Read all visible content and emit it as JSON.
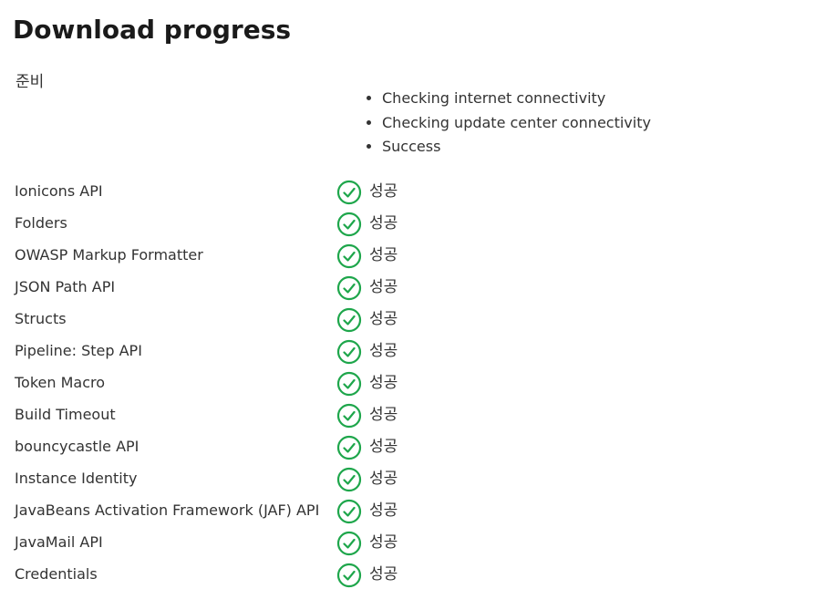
{
  "page": {
    "title": "Download progress"
  },
  "preparation": {
    "label": "준비",
    "steps": [
      "Checking internet connectivity",
      "Checking update center connectivity",
      "Success"
    ]
  },
  "plugins": [
    {
      "name": "Ionicons API",
      "status": "성공"
    },
    {
      "name": "Folders",
      "status": "성공"
    },
    {
      "name": "OWASP Markup Formatter",
      "status": "성공"
    },
    {
      "name": "JSON Path API",
      "status": "성공"
    },
    {
      "name": "Structs",
      "status": "성공"
    },
    {
      "name": "Pipeline: Step API",
      "status": "성공"
    },
    {
      "name": "Token Macro",
      "status": "성공"
    },
    {
      "name": "Build Timeout",
      "status": "성공"
    },
    {
      "name": "bouncycastle API",
      "status": "성공"
    },
    {
      "name": "Instance Identity",
      "status": "성공"
    },
    {
      "name": "JavaBeans Activation Framework (JAF) API",
      "status": "성공"
    },
    {
      "name": "JavaMail API",
      "status": "성공"
    },
    {
      "name": "Credentials",
      "status": "성공"
    }
  ],
  "colors": {
    "success": "#1ea64b"
  },
  "icons": {
    "status": "check-circle-icon"
  }
}
